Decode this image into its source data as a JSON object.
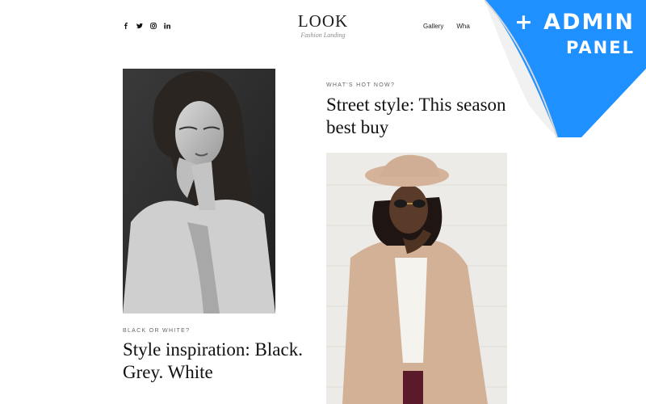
{
  "header": {
    "logo_title": "LOOK",
    "logo_subtitle": "Fashion Landing",
    "social_icons": [
      "facebook-icon",
      "twitter-icon",
      "instagram-icon",
      "linkedin-icon"
    ],
    "nav": [
      "Gallery",
      "Wha"
    ]
  },
  "articles": [
    {
      "eyebrow": "WHAT'S HOT NOW?",
      "title": "Street style: This season best buy"
    },
    {
      "eyebrow": "BLACK OR WHITE?",
      "title": "Style inspiration: Black. Grey. White"
    }
  ],
  "badge": {
    "line1": "+ ADMIN",
    "line2": "PANEL",
    "color": "#1e90ff"
  },
  "colors": {
    "text": "#111111",
    "muted": "#666666",
    "background": "#ffffff"
  }
}
